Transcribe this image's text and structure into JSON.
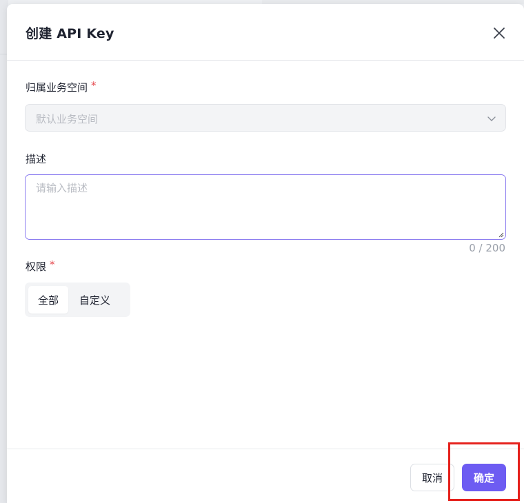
{
  "modal": {
    "title": "创建 API Key",
    "close_icon": "close-icon"
  },
  "form": {
    "workspace": {
      "label": "归属业务空间",
      "required_mark": "*",
      "value": "默认业务空间",
      "icon": "chevron-down-icon"
    },
    "description": {
      "label": "描述",
      "placeholder": "请输入描述",
      "value": "",
      "count": "0 / 200"
    },
    "permission": {
      "label": "权限",
      "required_mark": "*",
      "options": [
        {
          "label": "全部",
          "selected": true
        },
        {
          "label": "自定义",
          "selected": false
        }
      ]
    }
  },
  "footer": {
    "cancel_label": "取消",
    "ok_label": "确定"
  },
  "colors": {
    "accent": "#6d5cf2",
    "required": "#e5484d",
    "highlight": "#e5221d"
  }
}
